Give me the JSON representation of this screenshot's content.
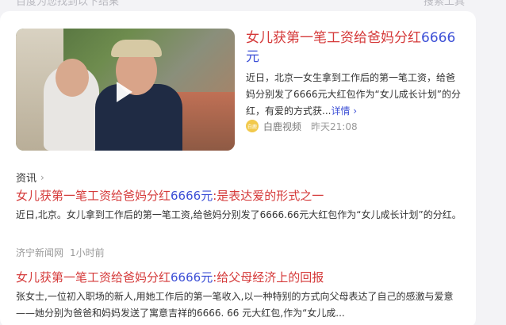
{
  "top_strip": {
    "left_text": "百度为您找到以下结果",
    "right_text": "搜索工具"
  },
  "featured": {
    "title_prefix": "女儿获第一笔工资给爸妈分红",
    "title_number": "6666元",
    "snippet": "近日，北京一女生拿到工作后的第一笔工资，给爸妈分别发了6666元大红包作为“女儿成长计划”的分红，有爱的方式获...",
    "more_label": "详情 ›",
    "source_name": "白鹿视频",
    "source_logo_text": "白鹿",
    "time": "昨天21:08"
  },
  "section": {
    "label": "资讯",
    "chevron": "›"
  },
  "news": [
    {
      "title_prefix": "女儿获第一笔工资给爸妈分红",
      "title_number": "6666元",
      "title_suffix": ":是表达爱的形式之一",
      "snippet": "近日,北京。女儿拿到工作后的第一笔工资,给爸妈分别发了6666.66元大红包作为“女儿成长计划”的分红。",
      "source_name": "济宁新闻网",
      "time": "1小时前"
    },
    {
      "title_prefix": "女儿获第一笔工资给爸妈分红",
      "title_number": "6666元",
      "title_suffix": ":给父母经济上的回报",
      "snippet": "张女士,一位初入职场的新人,用她工作后的第一笔收入,以一种特别的方式向父母表达了自己的感激与爱意——她分别为爸爸和妈妈发送了寓意吉祥的6666. 66 元大红包,作为“女儿成..."
    }
  ]
}
